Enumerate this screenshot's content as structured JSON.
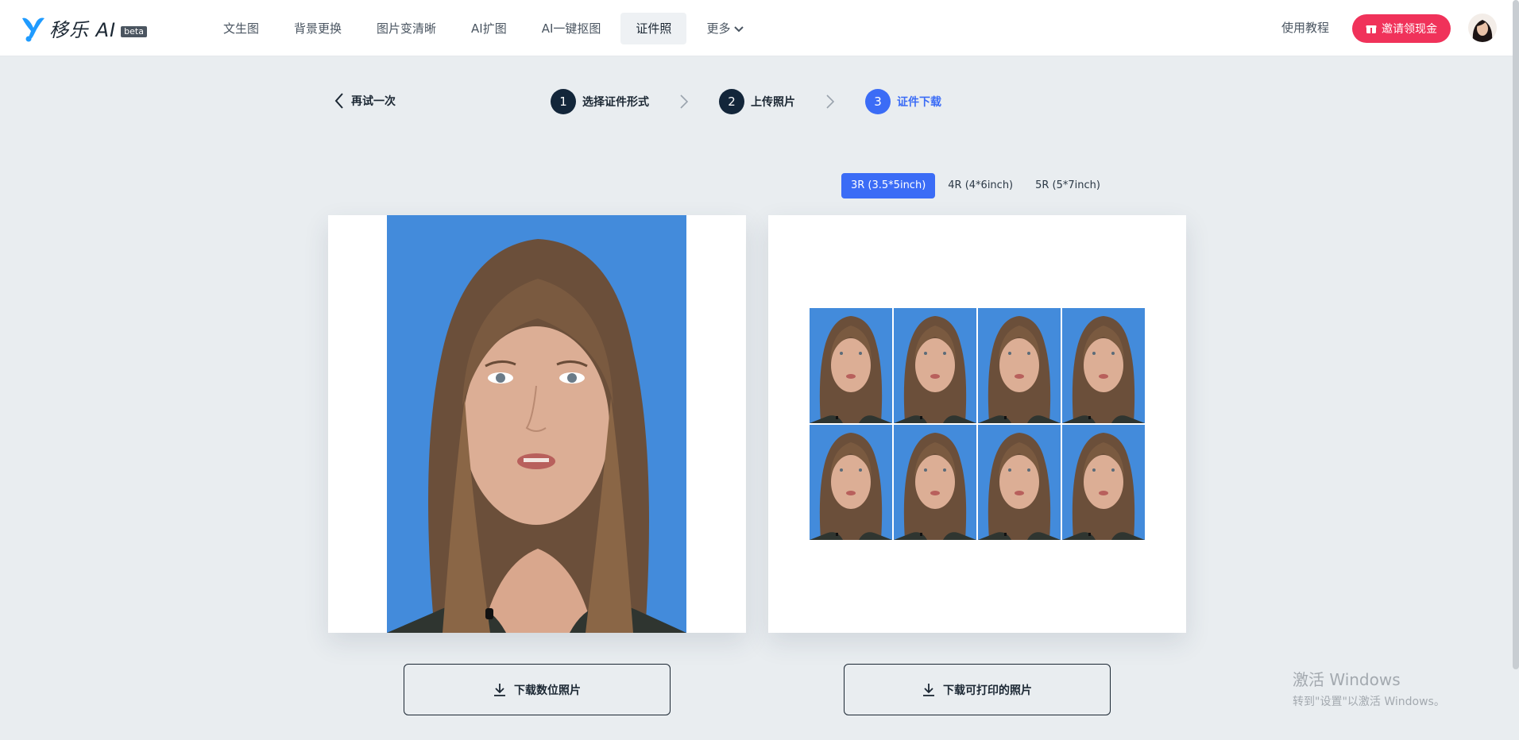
{
  "header": {
    "logo_text": "移乐 AI",
    "logo_badge": "beta",
    "nav": [
      {
        "label": "文生图"
      },
      {
        "label": "背景更换"
      },
      {
        "label": "图片变清晰"
      },
      {
        "label": "AI扩图"
      },
      {
        "label": "AI一键抠图"
      },
      {
        "label": "证件照",
        "active": true
      },
      {
        "label": "更多"
      }
    ],
    "tutorial_label": "使用教程",
    "invite_label": "邀请领现金"
  },
  "steps": {
    "retry_label": "再试一次",
    "items": [
      {
        "num": "1",
        "label": "选择证件形式"
      },
      {
        "num": "2",
        "label": "上传照片"
      },
      {
        "num": "3",
        "label": "证件下载",
        "active": true
      }
    ]
  },
  "print_sizes": {
    "options": [
      "3R (3.5*5inch)",
      "4R (4*6inch)",
      "5R (5*7inch)"
    ],
    "selected": "3R (3.5*5inch)"
  },
  "photo": {
    "background_color": "#438bdb"
  },
  "downloads": {
    "digital_label": "下载数位照片",
    "printable_label": "下载可打印的照片"
  },
  "watermark": {
    "title": "激活 Windows",
    "subtitle": "转到\"设置\"以激活 Windows。"
  },
  "colors": {
    "accent": "#3b6cf6",
    "invite": "#f0325a",
    "step_dark": "#13263a"
  }
}
